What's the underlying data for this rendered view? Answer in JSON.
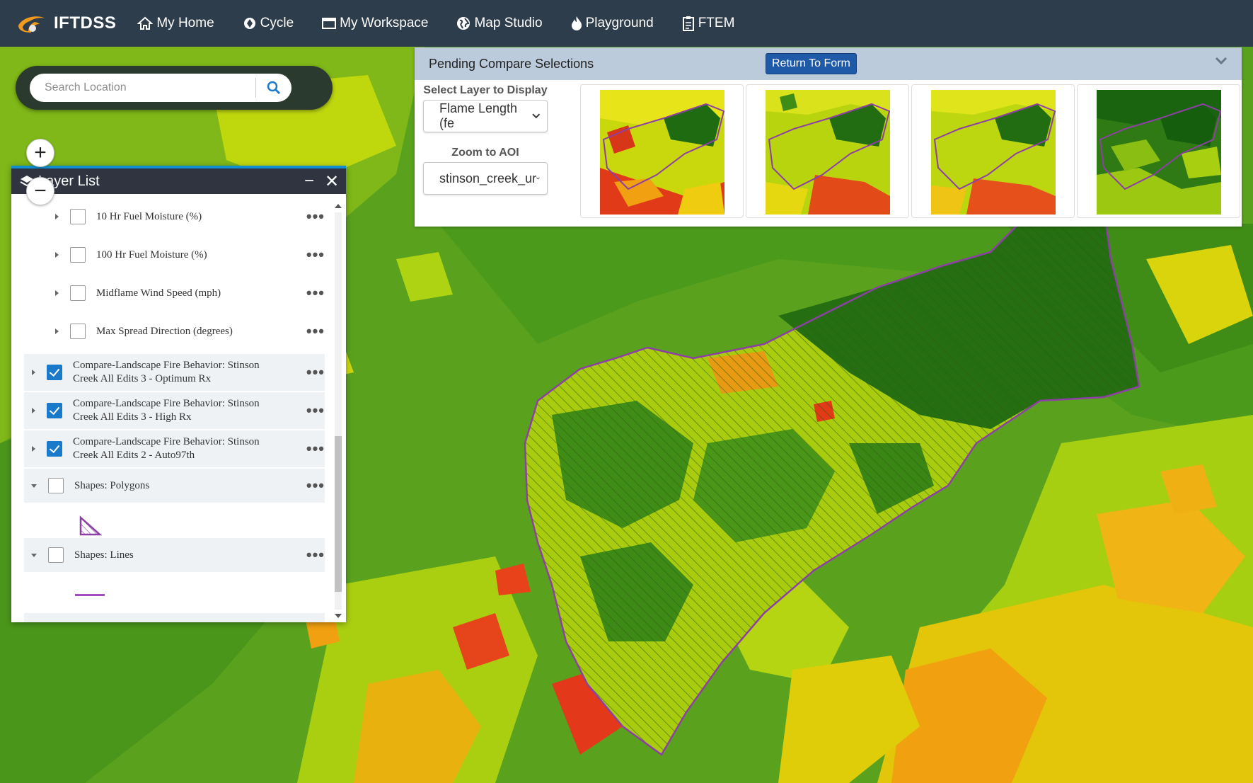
{
  "app": {
    "brand": "IFTDSS",
    "nav": [
      {
        "label": "My Home",
        "icon": "home-icon"
      },
      {
        "label": "Cycle",
        "icon": "cycle-icon"
      },
      {
        "label": "My Workspace",
        "icon": "workspace-icon"
      },
      {
        "label": "Map Studio",
        "icon": "globe-icon"
      },
      {
        "label": "Playground",
        "icon": "flame-icon"
      },
      {
        "label": "FTEM",
        "icon": "clipboard-icon"
      }
    ]
  },
  "search": {
    "placeholder": "Search Location"
  },
  "zoom": {
    "in": "+",
    "out": "−"
  },
  "layer_list": {
    "title": "Layer List",
    "minimize": "−",
    "close": "✕",
    "items": [
      {
        "label": "10 Hr Fuel Moisture (%)",
        "checked": false
      },
      {
        "label": "100 Hr Fuel Moisture (%)",
        "checked": false
      },
      {
        "label": "Midflame Wind Speed (mph)",
        "checked": false
      },
      {
        "label": "Max Spread Direction (degrees)",
        "checked": false
      },
      {
        "label": "Compare-Landscape Fire Behavior: Stinson Creek All Edits 3 - Optimum Rx",
        "checked": true
      },
      {
        "label": "Compare-Landscape Fire Behavior: Stinson Creek All Edits 3 - High Rx",
        "checked": true
      },
      {
        "label": "Compare-Landscape Fire Behavior: Stinson Creek All Edits 2 - Auto97th",
        "checked": true
      },
      {
        "label": "Shapes: Polygons",
        "checked": false
      },
      {
        "label": "Shapes: Lines",
        "checked": false
      }
    ],
    "more": "•••"
  },
  "compare": {
    "title": "Pending Compare Selections",
    "return_button": "Return To Form",
    "select_layer_label": "Select Layer to Display",
    "select_layer_value": "Flame Length (fe",
    "zoom_label": "Zoom to AOI",
    "zoom_value": "stinson_creek_ur"
  },
  "colors": {
    "nav_bg": "#2e3d4c",
    "accent": "#1f5aa8",
    "checkbox": "#1a79c9",
    "aoi_outline": "#8e3fa6",
    "map_green_dark": "#1f6b12",
    "map_green": "#4f9a1c",
    "map_yellow_green": "#b8d40c",
    "map_yellow": "#e6e600",
    "map_orange": "#f2a20c",
    "map_red": "#e8341a"
  }
}
